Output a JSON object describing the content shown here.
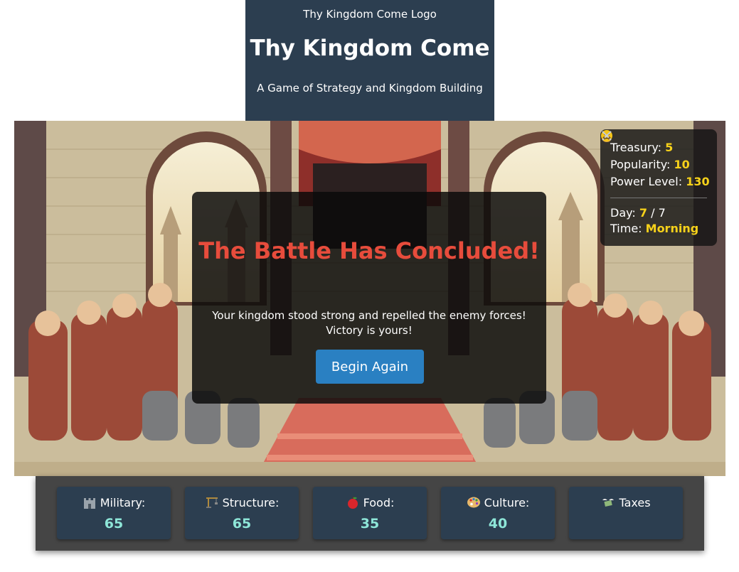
{
  "header": {
    "logo_text": "Thy Kingdom Come Logo",
    "title": "Thy Kingdom Come",
    "subtitle": "A Game of Strategy and Kingdom Building"
  },
  "stats": {
    "treasury": {
      "label": "Treasury:",
      "value": "5",
      "icon": "money-bag-icon"
    },
    "popularity": {
      "label": "Popularity:",
      "value": "10",
      "icon": "smiley-icon"
    },
    "power": {
      "label": "Power Level:",
      "value": "130",
      "icon": "crossed-swords-icon"
    },
    "day": {
      "label": "Day:",
      "value": "7",
      "separator": " / 7"
    },
    "time": {
      "label": "Time:",
      "value": "Morning"
    }
  },
  "modal": {
    "title": "The Battle Has Concluded!",
    "message": "Your kingdom stood strong and repelled the enemy forces! Victory is yours!",
    "button_label": "Begin Again"
  },
  "resources": {
    "military": {
      "label": "Military:",
      "value": "65",
      "icon": "castle-icon"
    },
    "structure": {
      "label": "Structure:",
      "value": "65",
      "icon": "construction-crane-icon"
    },
    "food": {
      "label": "Food:",
      "value": "35",
      "icon": "apple-icon"
    },
    "culture": {
      "label": "Culture:",
      "value": "40",
      "icon": "palette-icon"
    },
    "taxes": {
      "label": "Taxes",
      "value": "",
      "icon": "money-wings-icon"
    }
  },
  "colors": {
    "header_bg": "#2c3e50",
    "modal_title": "#e74c3c",
    "stat_value": "#f7d21a",
    "button_bg": "#2a80c2",
    "card_value": "#8ee6d8"
  }
}
